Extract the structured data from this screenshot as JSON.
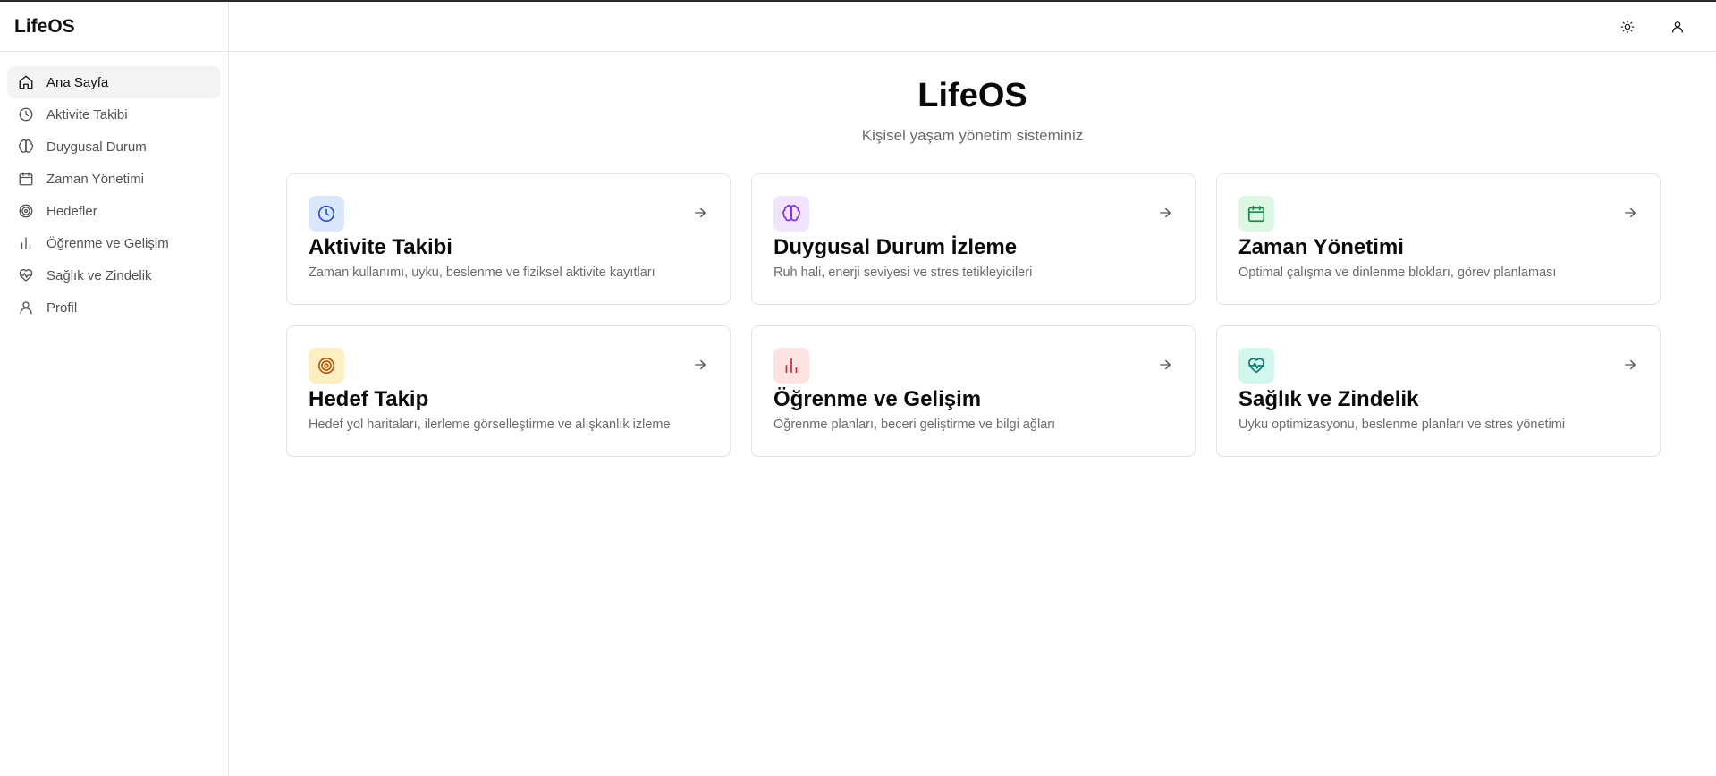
{
  "app": {
    "brand": "LifeOS"
  },
  "sidebar": {
    "items": [
      {
        "label": "Ana Sayfa",
        "icon": "home-icon",
        "active": true
      },
      {
        "label": "Aktivite Takibi",
        "icon": "clock-icon",
        "active": false
      },
      {
        "label": "Duygusal Durum",
        "icon": "brain-icon",
        "active": false
      },
      {
        "label": "Zaman Yönetimi",
        "icon": "calendar-icon",
        "active": false
      },
      {
        "label": "Hedefler",
        "icon": "target-icon",
        "active": false
      },
      {
        "label": "Öğrenme ve Gelişim",
        "icon": "bar-chart-icon",
        "active": false
      },
      {
        "label": "Sağlık ve Zindelik",
        "icon": "heart-pulse-icon",
        "active": false
      },
      {
        "label": "Profil",
        "icon": "user-icon",
        "active": false
      }
    ]
  },
  "header": {
    "theme_toggle_icon": "sun-icon",
    "user_icon": "user-icon"
  },
  "main": {
    "title": "LifeOS",
    "subtitle": "Kişisel yaşam yönetim sisteminiz",
    "cards": [
      {
        "title": "Aktivite Takibi",
        "description": "Zaman kullanımı, uyku, beslenme ve fiziksel aktivite kayıtları",
        "icon": "clock-icon",
        "icon_bg": "#dbe7fe",
        "icon_color": "#2450d6"
      },
      {
        "title": "Duygusal Durum İzleme",
        "description": "Ruh hali, enerji seviyesi ve stres tetikleyicileri",
        "icon": "brain-icon",
        "icon_bg": "#f1e5fe",
        "icon_color": "#8a2be2"
      },
      {
        "title": "Zaman Yönetimi",
        "description": "Optimal çalışma ve dinlenme blokları, görev planlaması",
        "icon": "calendar-icon",
        "icon_bg": "#dcf7e4",
        "icon_color": "#178a43"
      },
      {
        "title": "Hedef Takip",
        "description": "Hedef yol haritaları, ilerleme görselleştirme ve alışkanlık izleme",
        "icon": "target-icon",
        "icon_bg": "#fcf0c3",
        "icon_color": "#b3560e"
      },
      {
        "title": "Öğrenme ve Gelişim",
        "description": "Öğrenme planları, beceri geliştirme ve bilgi ağları",
        "icon": "bar-chart-icon",
        "icon_bg": "#fde2e2",
        "icon_color": "#c62828"
      },
      {
        "title": "Sağlık ve Zindelik",
        "description": "Uyku optimizasyonu, beslenme planları ve stres yönetimi",
        "icon": "heart-pulse-icon",
        "icon_bg": "#d2f7ef",
        "icon_color": "#0f766e"
      }
    ]
  }
}
